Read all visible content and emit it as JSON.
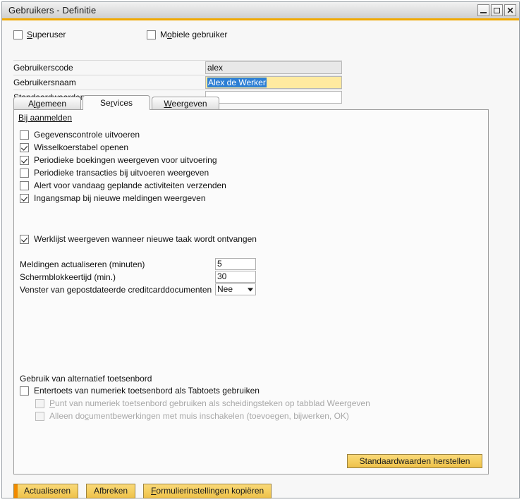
{
  "window": {
    "title": "Gebruikers - Definitie",
    "controls": {
      "minimize": "minimize-icon",
      "maximize": "maximize-icon",
      "close": "close-icon"
    },
    "accent_color": "#f0a800",
    "titlebar_underline_color": "#f0a800"
  },
  "top_options": [
    {
      "label": "Superuser",
      "checked": false,
      "accelerator": "S"
    },
    {
      "label": "Mobiele gebruiker",
      "checked": false,
      "accelerator": "o"
    }
  ],
  "fields": [
    {
      "label": "Gebruikerscode",
      "value": "alex",
      "state": "readonly",
      "placeholder": ""
    },
    {
      "label": "Gebruikersnaam",
      "value": "Alex de Werker",
      "state": "highlight-selected",
      "placeholder": ""
    },
    {
      "label": "Standaardwaarden",
      "value": "",
      "state": "normal",
      "placeholder": ""
    }
  ],
  "tabs": [
    {
      "label": "Algemeen",
      "active": false
    },
    {
      "label": "Services",
      "active": true
    },
    {
      "label": "Weergeven",
      "active": false
    }
  ],
  "panel": {
    "section_title": "Bij aanmelden",
    "login_options": [
      {
        "label": "Gegevenscontrole uitvoeren",
        "checked": false
      },
      {
        "label": "Wisselkoerstabel openen",
        "checked": true
      },
      {
        "label": "Periodieke boekingen weergeven voor uitvoering",
        "checked": true
      },
      {
        "label": "Periodieke transacties bij uitvoeren weergeven",
        "checked": false
      },
      {
        "label": "Alert voor vandaag geplande activiteiten verzenden",
        "checked": false
      },
      {
        "label": "Ingangsmap bij nieuwe meldingen weergeven",
        "checked": true
      }
    ],
    "worklist_option": {
      "label": "Werklijst weergeven wanneer nieuwe taak wordt ontvangen",
      "checked": true
    },
    "numeric_fields": [
      {
        "label": "Meldingen actualiseren (minuten)",
        "value": "5",
        "type": "text"
      },
      {
        "label": "Schermblokkeertijd (min.)",
        "value": "30",
        "type": "text"
      },
      {
        "label": "Venster van gepostdateerde creditcarddocumenten",
        "value": "Nee",
        "type": "select"
      }
    ],
    "keyboard_section": {
      "title": "Gebruik van alternatief toetsenbord",
      "options": [
        {
          "label": "Entertoets van numeriek toetsenbord als Tabtoets gebruiken",
          "checked": false,
          "disabled": false
        },
        {
          "label": "Punt van numeriek toetsenbord gebruiken als scheidingsteken op tabblad Weergeven",
          "checked": false,
          "disabled": true,
          "accelerator": "P"
        },
        {
          "label": "Alleen documentbewerkingen met muis inschakelen (toevoegen, bijwerken, OK)",
          "checked": false,
          "disabled": true,
          "accelerator": "c"
        }
      ]
    },
    "restore_button": "Standaardwaarden herstellen"
  },
  "footer": {
    "update_button": "Actualiseren",
    "cancel_button": "Afbreken",
    "copy_button": "Formulierinstellingen kopiëren"
  }
}
